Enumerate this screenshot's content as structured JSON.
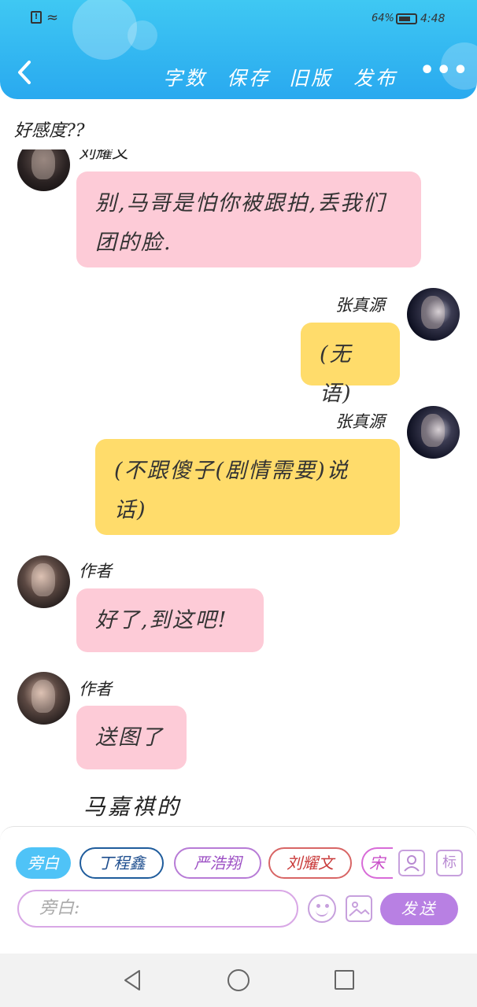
{
  "status_bar": {
    "battery": "64%",
    "time": "4:48"
  },
  "header": {
    "back_icon": "chevron-left-icon",
    "toolbar": [
      "字数",
      "保存",
      "旧版",
      "发布"
    ],
    "more_icon": "more-dots-icon"
  },
  "favor_text": "好感度??",
  "messages": [
    {
      "side": "left",
      "speaker": "刘耀文",
      "text": "别,马哥是怕你被跟拍,丢我们团的脸.",
      "color": "pink"
    },
    {
      "side": "right",
      "speaker": "张真源",
      "text": "(无语)",
      "color": "yellow"
    },
    {
      "side": "right",
      "speaker": "张真源",
      "text": "(不跟傻子(剧情需要)说话)",
      "color": "yellow"
    },
    {
      "side": "left",
      "speaker": "作者",
      "text": "好了,到这吧!",
      "color": "pink"
    },
    {
      "side": "left",
      "speaker": "作者",
      "text": "送图了",
      "color": "pink"
    }
  ],
  "caption": "马嘉祺的",
  "input_panel": {
    "chips": [
      "旁白",
      "丁程鑫",
      "严浩翔",
      "刘耀文",
      "宋"
    ],
    "role_icon_label": "person-icon",
    "tag_label": "标",
    "placeholder": "旁白:",
    "send_label": "发送"
  },
  "colors": {
    "header": "#29a9ef",
    "pink_bubble": "#fdcbd7",
    "yellow_bubble": "#ffdc6b",
    "send_button": "#b880e3"
  }
}
